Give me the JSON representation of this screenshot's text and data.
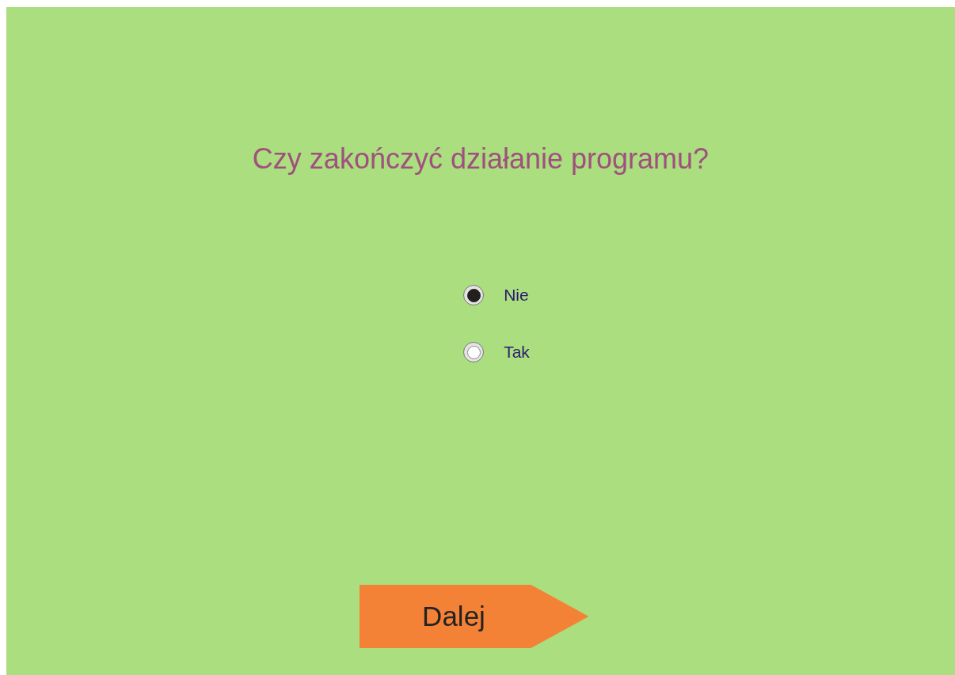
{
  "question": "Czy zakończyć działanie programu?",
  "options": [
    {
      "label": "Nie",
      "selected": true
    },
    {
      "label": "Tak",
      "selected": false
    }
  ],
  "next_button": {
    "label": "Dalej"
  }
}
